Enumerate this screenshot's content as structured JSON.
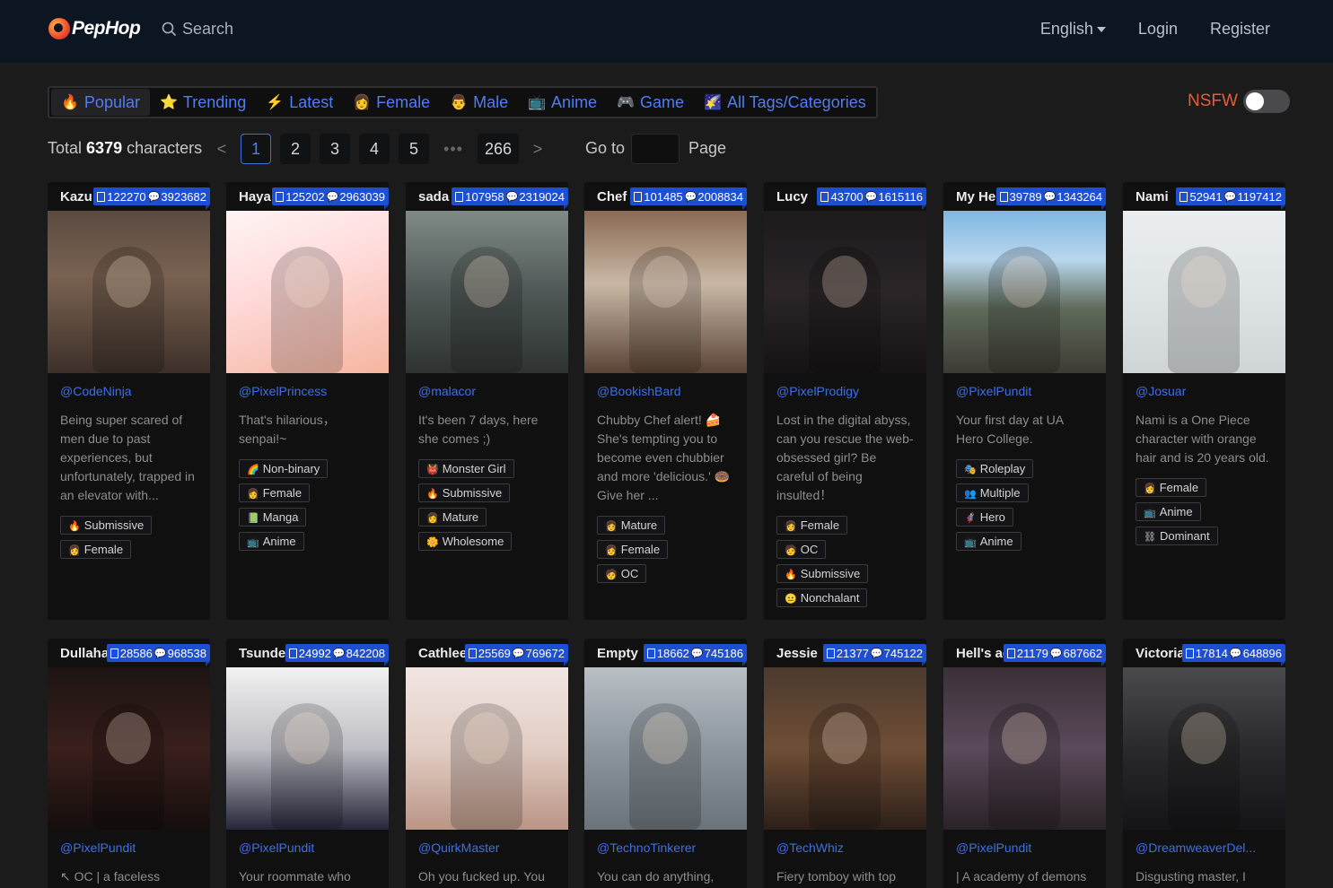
{
  "header": {
    "logo_text": "PepHop",
    "search_label": "Search",
    "language": "English",
    "login": "Login",
    "register": "Register"
  },
  "tabs": [
    {
      "icon": "🔥",
      "label": "Popular",
      "active": true
    },
    {
      "icon": "⭐",
      "label": "Trending"
    },
    {
      "icon": "⚡",
      "label": "Latest"
    },
    {
      "icon": "👩",
      "label": "Female"
    },
    {
      "icon": "👨",
      "label": "Male"
    },
    {
      "icon": "📺",
      "label": "Anime"
    },
    {
      "icon": "🎮",
      "label": "Game"
    },
    {
      "icon": "🌠",
      "label": "All Tags/Categories"
    }
  ],
  "nsfw": {
    "label": "NSFW",
    "enabled": false
  },
  "pagination": {
    "total_prefix": "Total",
    "total_count": "6379",
    "total_suffix": "characters",
    "prev": "<",
    "pages": [
      "1",
      "2",
      "3",
      "4",
      "5"
    ],
    "dots": "•••",
    "last": "266",
    "next": ">",
    "goto_label": "Go to",
    "page_label": "Page",
    "goto_value": ""
  },
  "cards": [
    {
      "name": "Kazu",
      "views": "122270",
      "chats": "3923682",
      "author": "@CodeNinja",
      "desc": "Being super scared of men due to past experiences, but unfortunately, trapped in an elevator with...",
      "tags": [
        {
          "e": "🔥",
          "t": "Submissive"
        },
        {
          "e": "👩",
          "t": "Female"
        }
      ]
    },
    {
      "name": "Haya",
      "views": "125202",
      "chats": "2963039",
      "author": "@PixelPrincess",
      "desc": "That's hilarious， senpai!~",
      "tags": [
        {
          "e": "🌈",
          "t": "Non-binary"
        },
        {
          "e": "👩",
          "t": "Female"
        },
        {
          "e": "📗",
          "t": "Manga"
        },
        {
          "e": "📺",
          "t": "Anime"
        }
      ]
    },
    {
      "name": "sada",
      "views": "107958",
      "chats": "2319024",
      "author": "@malacor",
      "desc": "It's been 7 days, here she comes ;)",
      "tags": [
        {
          "e": "👹",
          "t": "Monster Girl"
        },
        {
          "e": "🔥",
          "t": "Submissive"
        },
        {
          "e": "👩",
          "t": "Mature"
        },
        {
          "e": "🌼",
          "t": "Wholesome"
        }
      ]
    },
    {
      "name": "Chef",
      "views": "101485",
      "chats": "2008834",
      "author": "@BookishBard",
      "desc": "Chubby Chef alert! 🍰 She's tempting you to become even chubbier and more 'delicious.' 🍩 Give her ...",
      "tags": [
        {
          "e": "👩",
          "t": "Mature"
        },
        {
          "e": "👩",
          "t": "Female"
        },
        {
          "e": "🧑",
          "t": "OC"
        }
      ]
    },
    {
      "name": "Lucy",
      "views": "43700",
      "chats": "1615116",
      "author": "@PixelProdigy",
      "desc": "Lost in the digital abyss, can you rescue the web-obsessed girl? Be careful of being insulted！",
      "tags": [
        {
          "e": "👩",
          "t": "Female"
        },
        {
          "e": "🧑",
          "t": "OC"
        },
        {
          "e": "🔥",
          "t": "Submissive"
        },
        {
          "e": "😐",
          "t": "Nonchalant"
        }
      ]
    },
    {
      "name": "My Hero",
      "views": "39789",
      "chats": "1343264",
      "author": "@PixelPundit",
      "desc": "Your first day at UA Hero College.",
      "tags": [
        {
          "e": "🎭",
          "t": "Roleplay"
        },
        {
          "e": "👥",
          "t": "Multiple"
        },
        {
          "e": "🦸",
          "t": "Hero"
        },
        {
          "e": "📺",
          "t": "Anime"
        }
      ]
    },
    {
      "name": "Nami",
      "views": "52941",
      "chats": "1197412",
      "author": "@Josuar",
      "desc": "Nami is a One Piece character with orange hair and is 20 years old.",
      "tags": [
        {
          "e": "👩",
          "t": "Female"
        },
        {
          "e": "📺",
          "t": "Anime"
        },
        {
          "e": "⛓",
          "t": "Dominant"
        }
      ]
    },
    {
      "name": "Dullahan",
      "views": "28586",
      "chats": "968538",
      "author": "@PixelPundit",
      "desc": "↖ OC | a faceless",
      "tags": []
    },
    {
      "name": "Tsundere",
      "views": "24992",
      "chats": "842208",
      "author": "@PixelPundit",
      "desc": "Your roommate who tells",
      "tags": []
    },
    {
      "name": "Cathleen",
      "views": "25569",
      "chats": "769672",
      "author": "@QuirkMaster",
      "desc": "Oh you fucked up. You",
      "tags": []
    },
    {
      "name": "Empty",
      "views": "18662",
      "chats": "745186",
      "author": "@TechnoTinkerer",
      "desc": "You can do anything,",
      "tags": []
    },
    {
      "name": "Jessie",
      "views": "21377",
      "chats": "745122",
      "author": "@TechWhiz",
      "desc": "Fiery tomboy with top",
      "tags": []
    },
    {
      "name": "Hell's academy",
      "views": "21179",
      "chats": "687662",
      "author": "@PixelPundit",
      "desc": "| A academy of demons",
      "tags": []
    },
    {
      "name": "Victoria",
      "views": "17814",
      "chats": "648896",
      "author": "@DreamweaverDel...",
      "desc": "Disgusting master, I",
      "tags": []
    }
  ]
}
